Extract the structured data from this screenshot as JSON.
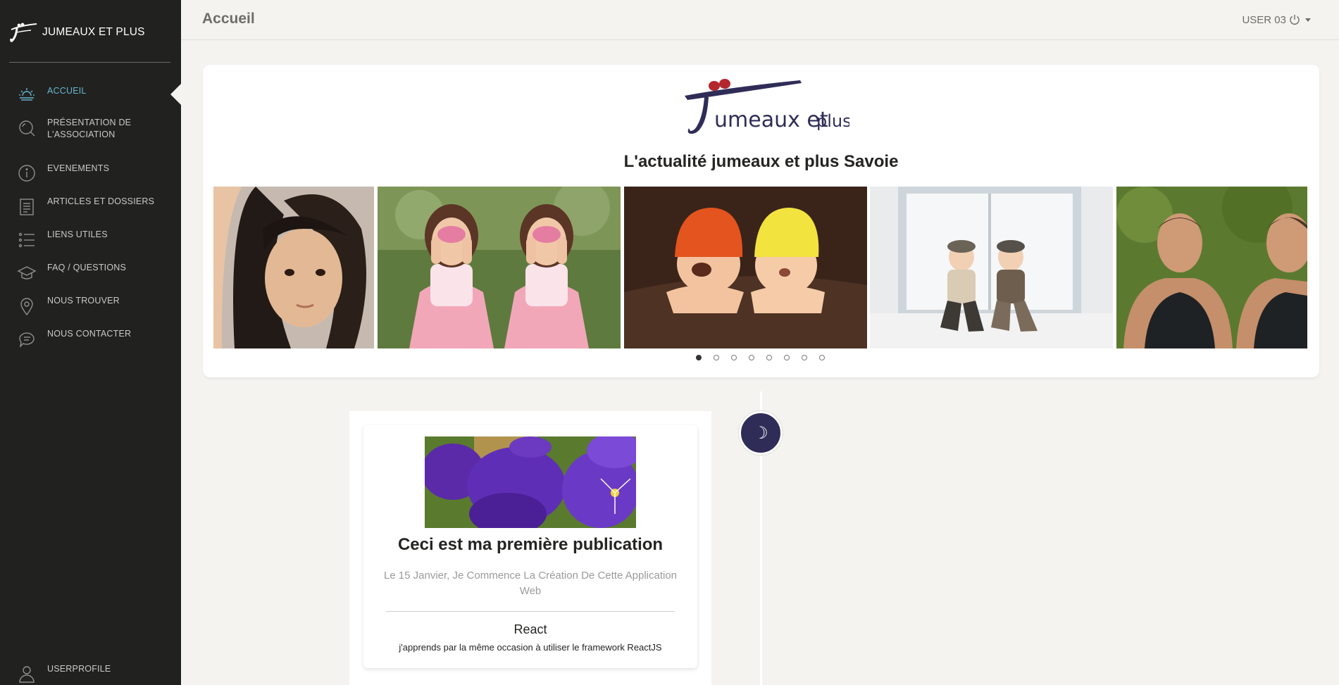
{
  "app": {
    "brand": "JUMEAUX ET PLUS",
    "page_title": "Accueil",
    "user_label": "USER 03"
  },
  "sidebar": {
    "items": [
      {
        "label": "ACCUEIL",
        "icon": "sunrise-icon",
        "active": true
      },
      {
        "label": "PRÉSENTATION DE L'ASSOCIATION",
        "icon": "magnifier-icon"
      },
      {
        "label": "EVENEMENTS",
        "icon": "info-icon"
      },
      {
        "label": "ARTICLES ET DOSSIERS",
        "icon": "document-icon"
      },
      {
        "label": "LIENS UTILES",
        "icon": "list-icon"
      },
      {
        "label": "FAQ / QUESTIONS",
        "icon": "graduation-cap-icon"
      },
      {
        "label": "NOUS TROUVER",
        "icon": "map-pin-icon"
      },
      {
        "label": "NOUS CONTACTER",
        "icon": "chat-icon"
      }
    ],
    "profile": {
      "label": "USERPROFILE",
      "icon": "user-icon"
    }
  },
  "hero": {
    "logo_text": "Jumeaux et plus",
    "subtitle": "L'actualité jumeaux et plus Savoie",
    "slides": [
      "girl-portrait-photo",
      "face-painted-twin-girls-photo",
      "twin-babies-hats-photo",
      "twin-boys-window-photo",
      "twin-men-levis-photo"
    ],
    "dots_count": 8,
    "active_dot": 0
  },
  "timeline": {
    "badge_icon": "moon-icon",
    "badge_glyph": "☽",
    "post": {
      "title": "Ceci est ma première publication",
      "description": "Le 15 Janvier, Je Commence La Création De Cette Application Web",
      "tag": "React",
      "note": "j'apprends par la même occasion à utiliser le framework ReactJS",
      "image": "purple-pansies-photo"
    }
  },
  "colors": {
    "sidebar_bg": "#212120",
    "accent": "#66b6cf",
    "page_bg": "#f4f3ef",
    "brand_navy": "#2f2d57",
    "brand_red": "#b3282e"
  }
}
